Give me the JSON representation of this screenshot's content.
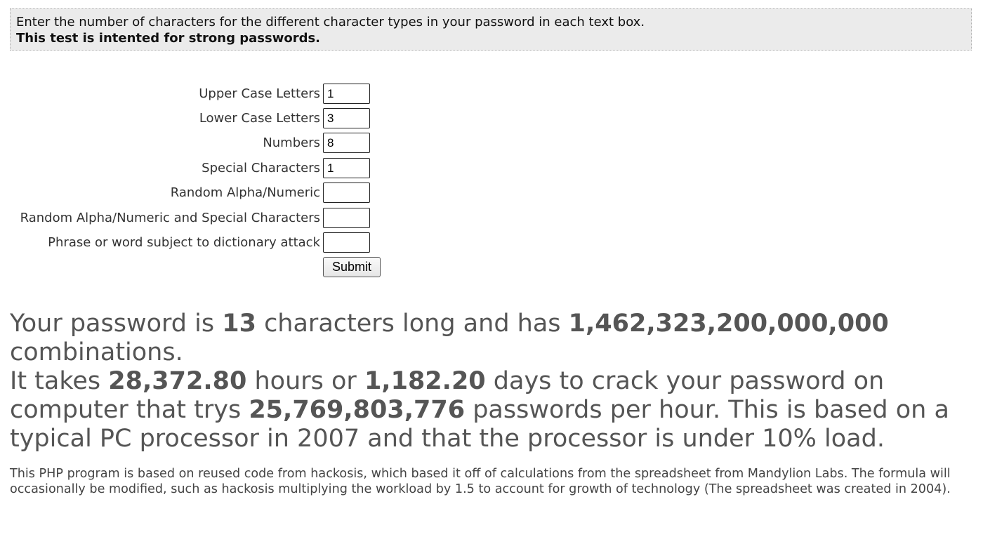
{
  "notice": {
    "line1": "Enter the number of characters for the different character types in your password in each text box.",
    "line2": "This test is intented for strong passwords."
  },
  "form": {
    "fields": [
      {
        "label": "Upper Case Letters",
        "value": "1"
      },
      {
        "label": "Lower Case Letters",
        "value": "3"
      },
      {
        "label": "Numbers",
        "value": "8"
      },
      {
        "label": "Special Characters",
        "value": "1"
      },
      {
        "label": "Random Alpha/Numeric",
        "value": ""
      },
      {
        "label": "Random Alpha/Numeric and Special Characters",
        "value": ""
      },
      {
        "label": "Phrase or word subject to dictionary attack",
        "value": ""
      }
    ],
    "submit_label": "Submit"
  },
  "result": {
    "t1": "Your password is ",
    "length": "13",
    "t2": " characters long and has ",
    "combinations": "1,462,323,200,000,000",
    "t3": " combinations.",
    "t4": "It takes ",
    "hours": "28,372.80",
    "t5": " hours or ",
    "days": "1,182.20",
    "t6": " days to crack your password on computer that trys ",
    "rate": "25,769,803,776",
    "t7": " passwords per hour. This is based on a typical PC processor in 2007 and that the processor is under 10% load."
  },
  "footnote": "This PHP program is based on reused code from hackosis, which based it off of calculations from the spreadsheet from Mandylion Labs. The formula will occasionally be modified, such as hackosis multiplying the workload by 1.5 to account for growth of technology (The spreadsheet was created in 2004)."
}
